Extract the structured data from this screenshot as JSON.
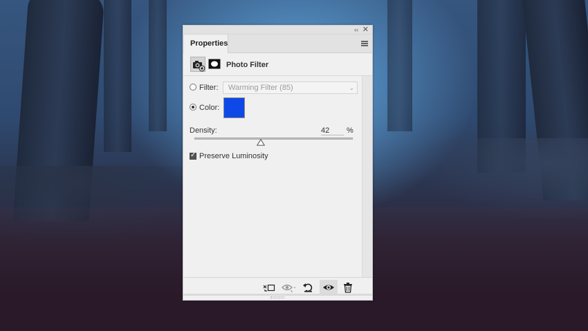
{
  "panel": {
    "tab_label": "Properties",
    "header_title": "Photo Filter",
    "filter": {
      "label": "Filter:",
      "selected": "Warming Filter (85)"
    },
    "color": {
      "label": "Color:",
      "value": "#0e49e7"
    },
    "density": {
      "label": "Density:",
      "value": "42",
      "unit": "%",
      "fraction": 0.42
    },
    "preserve": {
      "label": "Preserve Luminosity",
      "checked": true
    },
    "selected_mode": "color"
  },
  "icons": {
    "collapse": "collapse-icon",
    "close": "close-icon",
    "menu": "panel-menu-icon",
    "adjustment": "photo-filter-adjustment-icon",
    "mask": "layer-mask-icon",
    "clip": "clip-to-layer-icon",
    "view_previous": "view-previous-state-icon",
    "reset": "reset-icon",
    "visibility": "eye-icon",
    "delete": "trash-icon"
  },
  "glyphs": {
    "collapse": "‹‹",
    "close": "✕",
    "chevron": "⌄"
  }
}
